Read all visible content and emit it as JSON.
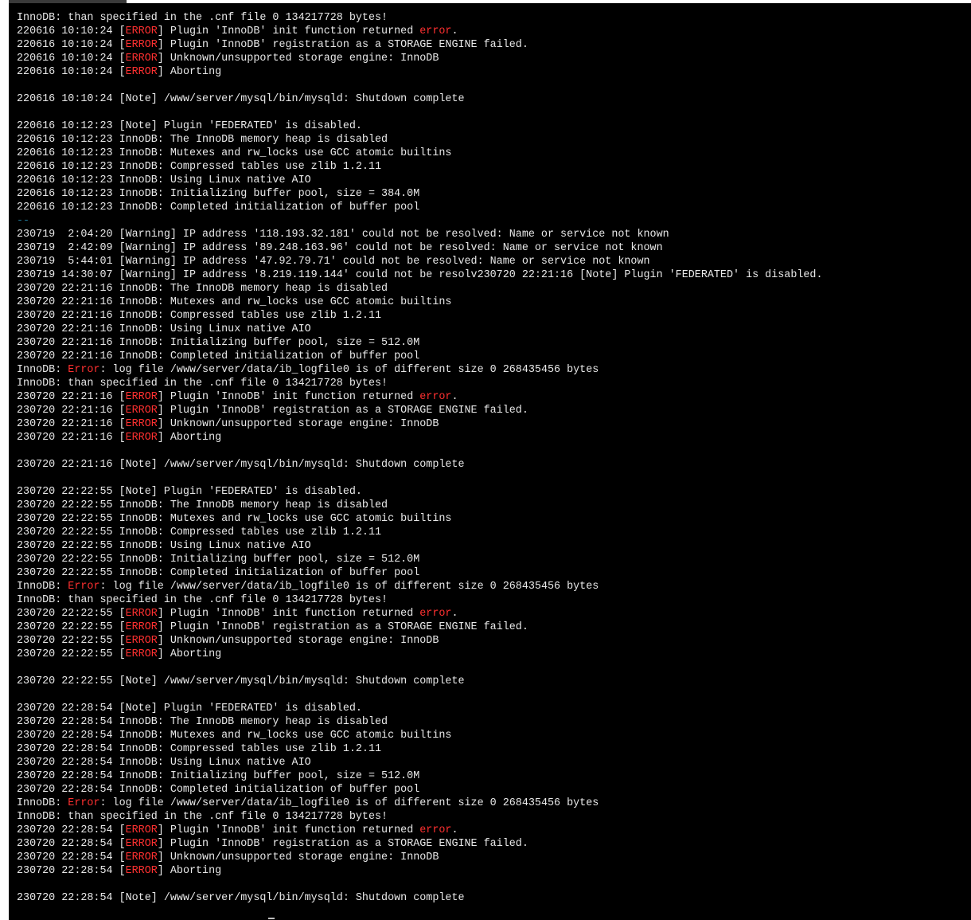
{
  "terminal": {
    "lines": [
      [
        {
          "t": "InnoDB: than specified in the .cnf file 0 134217728 bytes!"
        }
      ],
      [
        {
          "t": "220616 10:10:24 ["
        },
        {
          "t": "ERROR",
          "c": "err"
        },
        {
          "t": "] Plugin 'InnoDB' init function returned "
        },
        {
          "t": "error",
          "c": "err"
        },
        {
          "t": "."
        }
      ],
      [
        {
          "t": "220616 10:10:24 ["
        },
        {
          "t": "ERROR",
          "c": "err"
        },
        {
          "t": "] Plugin 'InnoDB' registration as a STORAGE ENGINE failed."
        }
      ],
      [
        {
          "t": "220616 10:10:24 ["
        },
        {
          "t": "ERROR",
          "c": "err"
        },
        {
          "t": "] Unknown/unsupported storage engine: InnoDB"
        }
      ],
      [
        {
          "t": "220616 10:10:24 ["
        },
        {
          "t": "ERROR",
          "c": "err"
        },
        {
          "t": "] Aborting"
        }
      ],
      [],
      [
        {
          "t": "220616 10:10:24 [Note] /www/server/mysql/bin/mysqld: Shutdown complete"
        }
      ],
      [],
      [
        {
          "t": "220616 10:12:23 [Note] Plugin 'FEDERATED' is disabled."
        }
      ],
      [
        {
          "t": "220616 10:12:23 InnoDB: The InnoDB memory heap is disabled"
        }
      ],
      [
        {
          "t": "220616 10:12:23 InnoDB: Mutexes and rw_locks use GCC atomic builtins"
        }
      ],
      [
        {
          "t": "220616 10:12:23 InnoDB: Compressed tables use zlib 1.2.11"
        }
      ],
      [
        {
          "t": "220616 10:12:23 InnoDB: Using Linux native AIO"
        }
      ],
      [
        {
          "t": "220616 10:12:23 InnoDB: Initializing buffer pool, size = 384.0M"
        }
      ],
      [
        {
          "t": "220616 10:12:23 InnoDB: Completed initialization of buffer pool"
        }
      ],
      [
        {
          "t": "--",
          "c": "sep"
        }
      ],
      [
        {
          "t": "230719  2:04:20 [Warning] IP address '118.193.32.181' could not be resolved: Name or service not known"
        }
      ],
      [
        {
          "t": "230719  2:42:09 [Warning] IP address '89.248.163.96' could not be resolved: Name or service not known"
        }
      ],
      [
        {
          "t": "230719  5:44:01 [Warning] IP address '47.92.79.71' could not be resolved: Name or service not known"
        }
      ],
      [
        {
          "t": "230719 14:30:07 [Warning] IP address '8.219.119.144' could not be resolv230720 22:21:16 [Note] Plugin 'FEDERATED' is disabled."
        }
      ],
      [
        {
          "t": "230720 22:21:16 InnoDB: The InnoDB memory heap is disabled"
        }
      ],
      [
        {
          "t": "230720 22:21:16 InnoDB: Mutexes and rw_locks use GCC atomic builtins"
        }
      ],
      [
        {
          "t": "230720 22:21:16 InnoDB: Compressed tables use zlib 1.2.11"
        }
      ],
      [
        {
          "t": "230720 22:21:16 InnoDB: Using Linux native AIO"
        }
      ],
      [
        {
          "t": "230720 22:21:16 InnoDB: Initializing buffer pool, size = 512.0M"
        }
      ],
      [
        {
          "t": "230720 22:21:16 InnoDB: Completed initialization of buffer pool"
        }
      ],
      [
        {
          "t": "InnoDB: "
        },
        {
          "t": "Error",
          "c": "err"
        },
        {
          "t": ": log file /www/server/data/ib_logfile0 is of different size 0 268435456 bytes"
        }
      ],
      [
        {
          "t": "InnoDB: than specified in the .cnf file 0 134217728 bytes!"
        }
      ],
      [
        {
          "t": "230720 22:21:16 ["
        },
        {
          "t": "ERROR",
          "c": "err"
        },
        {
          "t": "] Plugin 'InnoDB' init function returned "
        },
        {
          "t": "error",
          "c": "err"
        },
        {
          "t": "."
        }
      ],
      [
        {
          "t": "230720 22:21:16 ["
        },
        {
          "t": "ERROR",
          "c": "err"
        },
        {
          "t": "] Plugin 'InnoDB' registration as a STORAGE ENGINE failed."
        }
      ],
      [
        {
          "t": "230720 22:21:16 ["
        },
        {
          "t": "ERROR",
          "c": "err"
        },
        {
          "t": "] Unknown/unsupported storage engine: InnoDB"
        }
      ],
      [
        {
          "t": "230720 22:21:16 ["
        },
        {
          "t": "ERROR",
          "c": "err"
        },
        {
          "t": "] Aborting"
        }
      ],
      [],
      [
        {
          "t": "230720 22:21:16 [Note] /www/server/mysql/bin/mysqld: Shutdown complete"
        }
      ],
      [],
      [
        {
          "t": "230720 22:22:55 [Note] Plugin 'FEDERATED' is disabled."
        }
      ],
      [
        {
          "t": "230720 22:22:55 InnoDB: The InnoDB memory heap is disabled"
        }
      ],
      [
        {
          "t": "230720 22:22:55 InnoDB: Mutexes and rw_locks use GCC atomic builtins"
        }
      ],
      [
        {
          "t": "230720 22:22:55 InnoDB: Compressed tables use zlib 1.2.11"
        }
      ],
      [
        {
          "t": "230720 22:22:55 InnoDB: Using Linux native AIO"
        }
      ],
      [
        {
          "t": "230720 22:22:55 InnoDB: Initializing buffer pool, size = 512.0M"
        }
      ],
      [
        {
          "t": "230720 22:22:55 InnoDB: Completed initialization of buffer pool"
        }
      ],
      [
        {
          "t": "InnoDB: "
        },
        {
          "t": "Error",
          "c": "err"
        },
        {
          "t": ": log file /www/server/data/ib_logfile0 is of different size 0 268435456 bytes"
        }
      ],
      [
        {
          "t": "InnoDB: than specified in the .cnf file 0 134217728 bytes!"
        }
      ],
      [
        {
          "t": "230720 22:22:55 ["
        },
        {
          "t": "ERROR",
          "c": "err"
        },
        {
          "t": "] Plugin 'InnoDB' init function returned "
        },
        {
          "t": "error",
          "c": "err"
        },
        {
          "t": "."
        }
      ],
      [
        {
          "t": "230720 22:22:55 ["
        },
        {
          "t": "ERROR",
          "c": "err"
        },
        {
          "t": "] Plugin 'InnoDB' registration as a STORAGE ENGINE failed."
        }
      ],
      [
        {
          "t": "230720 22:22:55 ["
        },
        {
          "t": "ERROR",
          "c": "err"
        },
        {
          "t": "] Unknown/unsupported storage engine: InnoDB"
        }
      ],
      [
        {
          "t": "230720 22:22:55 ["
        },
        {
          "t": "ERROR",
          "c": "err"
        },
        {
          "t": "] Aborting"
        }
      ],
      [],
      [
        {
          "t": "230720 22:22:55 [Note] /www/server/mysql/bin/mysqld: Shutdown complete"
        }
      ],
      [],
      [
        {
          "t": "230720 22:28:54 [Note] Plugin 'FEDERATED' is disabled."
        }
      ],
      [
        {
          "t": "230720 22:28:54 InnoDB: The InnoDB memory heap is disabled"
        }
      ],
      [
        {
          "t": "230720 22:28:54 InnoDB: Mutexes and rw_locks use GCC atomic builtins"
        }
      ],
      [
        {
          "t": "230720 22:28:54 InnoDB: Compressed tables use zlib 1.2.11"
        }
      ],
      [
        {
          "t": "230720 22:28:54 InnoDB: Using Linux native AIO"
        }
      ],
      [
        {
          "t": "230720 22:28:54 InnoDB: Initializing buffer pool, size = 512.0M"
        }
      ],
      [
        {
          "t": "230720 22:28:54 InnoDB: Completed initialization of buffer pool"
        }
      ],
      [
        {
          "t": "InnoDB: "
        },
        {
          "t": "Error",
          "c": "err"
        },
        {
          "t": ": log file /www/server/data/ib_logfile0 is of different size 0 268435456 bytes"
        }
      ],
      [
        {
          "t": "InnoDB: than specified in the .cnf file 0 134217728 bytes!"
        }
      ],
      [
        {
          "t": "230720 22:28:54 ["
        },
        {
          "t": "ERROR",
          "c": "err"
        },
        {
          "t": "] Plugin 'InnoDB' init function returned "
        },
        {
          "t": "error",
          "c": "err"
        },
        {
          "t": "."
        }
      ],
      [
        {
          "t": "230720 22:28:54 ["
        },
        {
          "t": "ERROR",
          "c": "err"
        },
        {
          "t": "] Plugin 'InnoDB' registration as a STORAGE ENGINE failed."
        }
      ],
      [
        {
          "t": "230720 22:28:54 ["
        },
        {
          "t": "ERROR",
          "c": "err"
        },
        {
          "t": "] Unknown/unsupported storage engine: InnoDB"
        }
      ],
      [
        {
          "t": "230720 22:28:54 ["
        },
        {
          "t": "ERROR",
          "c": "err"
        },
        {
          "t": "] Aborting"
        }
      ],
      [],
      [
        {
          "t": "230720 22:28:54 [Note] /www/server/mysql/bin/mysqld: Shutdown complete"
        }
      ]
    ]
  },
  "colors": {
    "background": "#000000",
    "text": "#e8e8e8",
    "error": "#ff3030",
    "separator": "#1f6f8b"
  }
}
